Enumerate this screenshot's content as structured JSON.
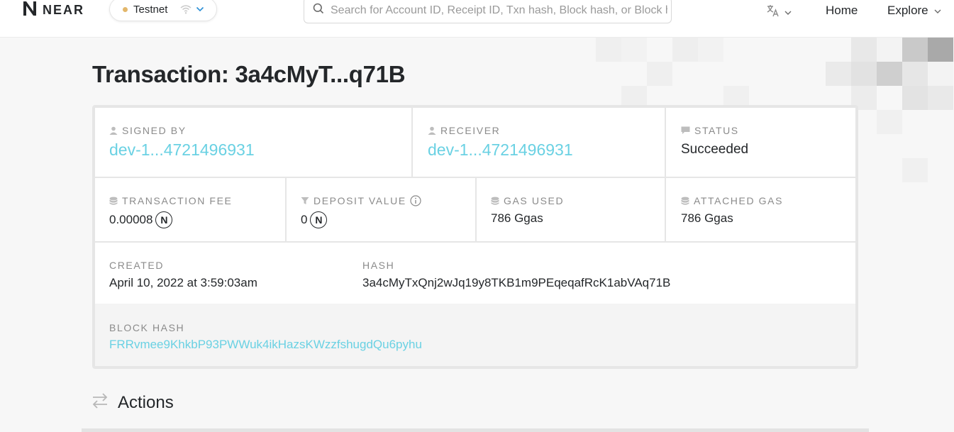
{
  "header": {
    "logo_text": "NEAR",
    "network": {
      "label": "Testnet",
      "dot_color": "#e3b76b"
    },
    "search": {
      "placeholder": "Search for Account ID, Receipt ID, Txn hash, Block hash, or Block height"
    },
    "nav": {
      "home": "Home",
      "explore": "Explore"
    },
    "language_icon": "translate-icon"
  },
  "page": {
    "title": "Transaction: 3a4cMyT...q71B"
  },
  "transaction": {
    "signed_by": {
      "label": "SIGNED BY",
      "value": "dev-1...4721496931"
    },
    "receiver": {
      "label": "RECEIVER",
      "value": "dev-1...4721496931"
    },
    "status": {
      "label": "STATUS",
      "value": "Succeeded"
    },
    "fee": {
      "label": "TRANSACTION FEE",
      "value": "0.00008",
      "unit_icon": "N"
    },
    "deposit": {
      "label": "DEPOSIT VALUE",
      "value": "0",
      "unit_icon": "N"
    },
    "gas_used": {
      "label": "GAS USED",
      "value": "786 Ggas"
    },
    "attached_gas": {
      "label": "ATTACHED GAS",
      "value": "786 Ggas"
    },
    "created": {
      "label": "CREATED",
      "value": "April 10, 2022 at 3:59:03am"
    },
    "hash": {
      "label": "HASH",
      "value": "3a4cMyTxQnj2wJq19y8TKB1m9PEqeqafRcK1abVAq71B"
    },
    "block_hash": {
      "label": "BLOCK HASH",
      "value": "FRRvmee9KhkbP93PWWuk4ikHazsKWzzfshugdQu6pyhu"
    }
  },
  "actions": {
    "title": "Actions"
  },
  "colors": {
    "link": "#6ad1e3",
    "text": "#24272a",
    "label": "#8b8b8b"
  }
}
